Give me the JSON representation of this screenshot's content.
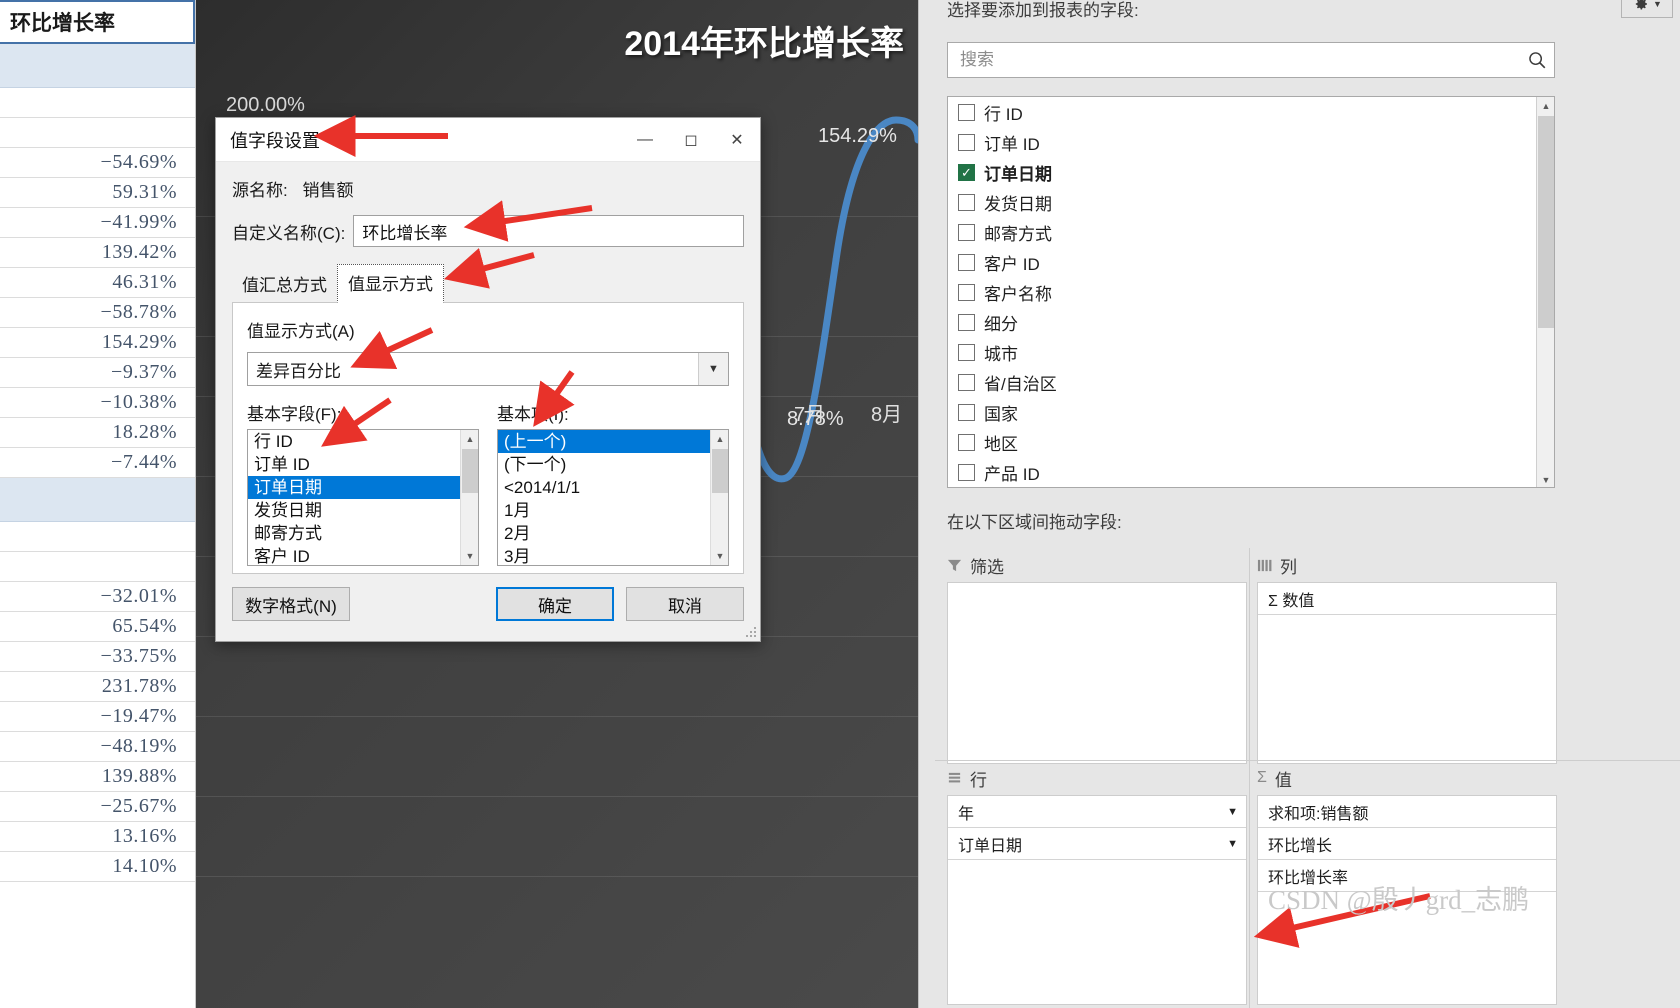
{
  "worksheet": {
    "column_header": "环比增长率",
    "rows": [
      {
        "value": "",
        "state": "selected"
      },
      {
        "value": "",
        "state": "blank"
      },
      {
        "value": "",
        "state": "blank"
      },
      {
        "value": "−54.69%",
        "state": "normal"
      },
      {
        "value": "59.31%",
        "state": "normal"
      },
      {
        "value": "−41.99%",
        "state": "normal"
      },
      {
        "value": "139.42%",
        "state": "normal"
      },
      {
        "value": "46.31%",
        "state": "normal"
      },
      {
        "value": "−58.78%",
        "state": "normal"
      },
      {
        "value": "154.29%",
        "state": "normal"
      },
      {
        "value": "−9.37%",
        "state": "normal"
      },
      {
        "value": "−10.38%",
        "state": "normal"
      },
      {
        "value": "18.28%",
        "state": "normal"
      },
      {
        "value": "−7.44%",
        "state": "normal"
      },
      {
        "value": "",
        "state": "selected"
      },
      {
        "value": "",
        "state": "blank"
      },
      {
        "value": "",
        "state": "blank"
      },
      {
        "value": "−32.01%",
        "state": "normal"
      },
      {
        "value": "65.54%",
        "state": "normal"
      },
      {
        "value": "−33.75%",
        "state": "normal"
      },
      {
        "value": "231.78%",
        "state": "normal"
      },
      {
        "value": "−19.47%",
        "state": "normal"
      },
      {
        "value": "−48.19%",
        "state": "normal"
      },
      {
        "value": "139.88%",
        "state": "normal"
      },
      {
        "value": "−25.67%",
        "state": "normal"
      },
      {
        "value": "13.16%",
        "state": "normal"
      },
      {
        "value": "14.10%",
        "state": "normal"
      }
    ]
  },
  "chart_data": {
    "type": "line",
    "title": "2014年环比增长率",
    "xlabel": "",
    "ylabel": "",
    "ylim": [
      -100,
      200
    ],
    "y_axis_top_label": "200.00%",
    "grid": true,
    "categories": [
      "7月",
      "8月"
    ],
    "visible_data_labels": [
      "154.29%",
      "8.78%"
    ],
    "series": [
      {
        "name": "环比增长率",
        "color": "#4a87c4",
        "values": [
          -58.78,
          154.29
        ]
      }
    ]
  },
  "dialog": {
    "title": "值字段设置",
    "minimize_icon": "minimize-icon",
    "maximize_icon": "maximize-icon",
    "close_icon": "close-icon",
    "source_name_label": "源名称:",
    "source_name_value": "销售额",
    "custom_name_label": "自定义名称(C):",
    "custom_name_value": "环比增长率",
    "tabs": [
      {
        "label": "值汇总方式",
        "active": false
      },
      {
        "label": "值显示方式",
        "active": true
      }
    ],
    "show_as_label": "值显示方式(A)",
    "show_as_selected": "差异百分比",
    "base_field_label": "基本字段(F):",
    "base_field_items": [
      "行 ID",
      "订单 ID",
      "订单日期",
      "发货日期",
      "邮寄方式",
      "客户 ID"
    ],
    "base_field_selected": "订单日期",
    "base_item_label": "基本项(I):",
    "base_item_items": [
      "(上一个)",
      "(下一个)",
      "<2014/1/1",
      "1月",
      "2月",
      "3月"
    ],
    "base_item_selected": "(上一个)",
    "buttons": {
      "number_format": "数字格式(N)",
      "ok": "确定",
      "cancel": "取消"
    }
  },
  "pivot_pane": {
    "title": "选择要添加到报表的字段:",
    "gear_icon": "gear-icon",
    "search_placeholder": "搜索",
    "search_value": "",
    "search_icon": "search-icon",
    "fields": [
      {
        "label": "行 ID",
        "checked": false
      },
      {
        "label": "订单 ID",
        "checked": false
      },
      {
        "label": "订单日期",
        "checked": true
      },
      {
        "label": "发货日期",
        "checked": false
      },
      {
        "label": "邮寄方式",
        "checked": false
      },
      {
        "label": "客户 ID",
        "checked": false
      },
      {
        "label": "客户名称",
        "checked": false
      },
      {
        "label": "细分",
        "checked": false
      },
      {
        "label": "城市",
        "checked": false
      },
      {
        "label": "省/自治区",
        "checked": false
      },
      {
        "label": "国家",
        "checked": false
      },
      {
        "label": "地区",
        "checked": false
      },
      {
        "label": "产品 ID",
        "checked": false
      }
    ],
    "drag_label": "在以下区域间拖动字段:",
    "zones": [
      {
        "id": "filters",
        "icon": "filter-icon",
        "label": "筛选",
        "items": []
      },
      {
        "id": "columns",
        "icon": "columns-icon",
        "label": "列",
        "items": [
          {
            "label": "Σ 数值"
          }
        ]
      },
      {
        "id": "rows",
        "icon": "rows-icon",
        "label": "行",
        "items": [
          {
            "label": "年"
          },
          {
            "label": "订单日期"
          }
        ]
      },
      {
        "id": "values",
        "icon": "sigma-icon",
        "label": "值",
        "items": [
          {
            "label": "求和项:销售额"
          },
          {
            "label": "环比增长"
          },
          {
            "label": "环比增长率"
          }
        ]
      }
    ]
  },
  "annotations": {
    "arrow_color": "#e8322a",
    "arrows": [
      {
        "target": "dialog-title"
      },
      {
        "target": "custom-name-input"
      },
      {
        "target": "tab-show-as"
      },
      {
        "target": "show-as-select"
      },
      {
        "target": "base-field-selected"
      },
      {
        "target": "base-item-selected"
      },
      {
        "target": "values-zone-item-growth-rate"
      }
    ]
  },
  "watermark": {
    "text": "CSDN @殷丿grd_志鹏"
  }
}
